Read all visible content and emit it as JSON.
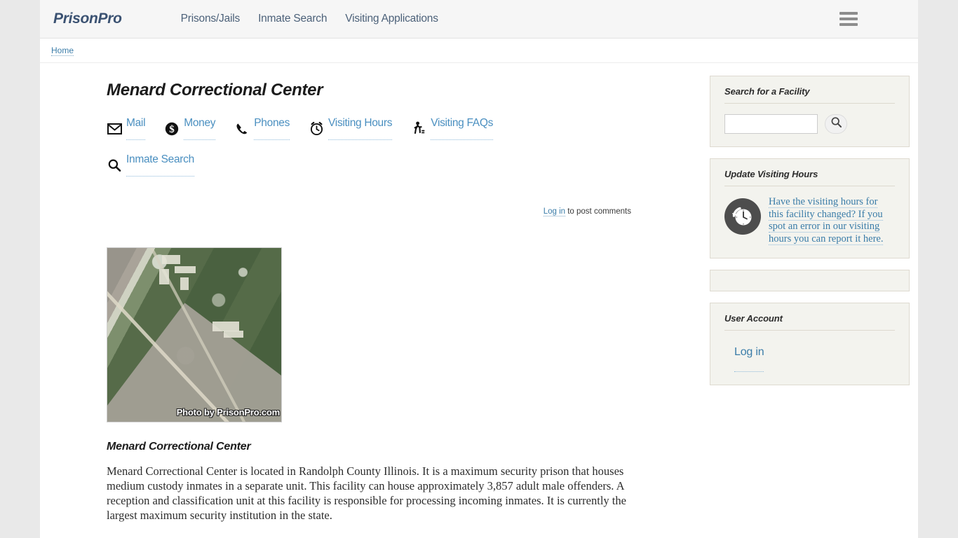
{
  "header": {
    "logo": "PrisonPro",
    "nav": [
      {
        "label": "Prisons/Jails"
      },
      {
        "label": "Inmate Search"
      },
      {
        "label": "Visiting Applications"
      }
    ],
    "menu_icon": "hamburger-icon"
  },
  "breadcrumb": {
    "home": "Home"
  },
  "main": {
    "title": "Menard Correctional Center",
    "icon_links": [
      {
        "label": "Mail",
        "icon": "envelope-icon"
      },
      {
        "label": "Money",
        "icon": "dollar-circle-icon"
      },
      {
        "label": "Phones",
        "icon": "phone-icon"
      },
      {
        "label": "Visiting Hours",
        "icon": "alarm-clock-icon"
      },
      {
        "label": "Visiting FAQs",
        "icon": "walking-person-icon"
      },
      {
        "label": "Inmate Search",
        "icon": "search-icon"
      }
    ],
    "comments": {
      "login_label": "Log in",
      "suffix": " to post comments"
    },
    "photo": {
      "watermark": "Photo by PrisonPro.com"
    },
    "subheading": "Menard Correctional Center",
    "paragraph": "Menard Correctional Center is located in Randolph County Illinois.  It is a maximum security prison that houses medium custody inmates in a separate unit.  This facility can house approximately 3,857 adult male offenders.  A reception and classification unit at this facility is responsible for processing incoming inmates.  It is currently the largest maximum security institution in the state."
  },
  "sidebar": {
    "search_block": {
      "title": "Search for a Facility",
      "input_value": "",
      "input_placeholder": "",
      "button_icon": "search-icon"
    },
    "update_block": {
      "title": "Update Visiting Hours",
      "icon": "clock-refresh-icon",
      "link_text": "Have the visiting hours for this facility changed?  If you spot an error in our visiting hours you can report it here."
    },
    "user_block": {
      "title": "User Account",
      "login_label": "Log in"
    }
  },
  "colors": {
    "page_bg": "#e9e9e9",
    "header_bg": "#f6f6f6",
    "logo": "#3b5272",
    "link": "#3a7ca8",
    "icon_link": "#4a8fc0",
    "block_bg": "#f3f3ee",
    "block_border": "#dedad0"
  }
}
